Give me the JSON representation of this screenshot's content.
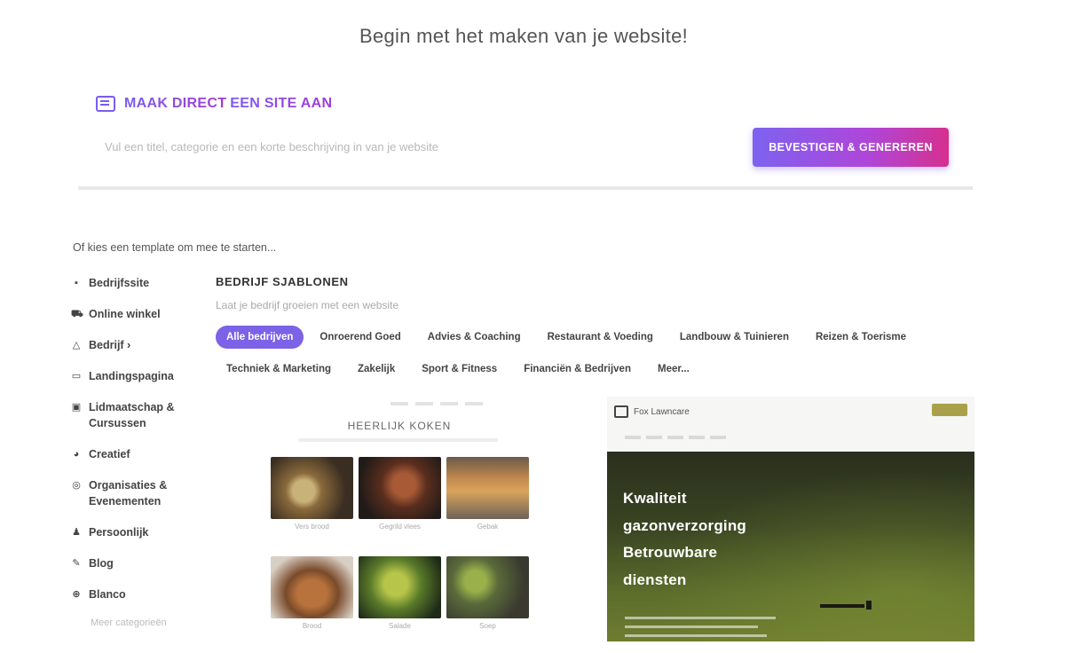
{
  "page": {
    "title": "Begin met het maken van je website!"
  },
  "ai_section": {
    "heading_part1": "MAAK DIRECT",
    "heading_part2": "EEN SITE AAN",
    "input_placeholder": "Vul een titel, categorie en een korte beschrijving in van je website",
    "button_label": "BEVESTIGEN & GENEREREN"
  },
  "choose_text": "Of kies een template om mee te starten...",
  "sidebar": {
    "items": [
      {
        "label": "Bedrijfssite",
        "icon": "briefcase-icon"
      },
      {
        "label": "Online winkel",
        "icon": "cart-icon"
      },
      {
        "label": "Bedrijf ›",
        "icon": "building-icon"
      },
      {
        "label": "Landingspagina",
        "icon": "landing-page-icon"
      },
      {
        "label": "Lidmaatschap & Cursussen",
        "icon": "membership-icon"
      },
      {
        "label": "Creatief",
        "icon": "palette-icon"
      },
      {
        "label": "Organisaties & Evenementen",
        "icon": "globe-icon"
      },
      {
        "label": "Persoonlijk",
        "icon": "person-icon"
      },
      {
        "label": "Blog",
        "icon": "pen-icon"
      },
      {
        "label": "Blanco",
        "icon": "plus-circle-icon"
      }
    ],
    "more_label": "Meer categorieën"
  },
  "templates": {
    "title": "BEDRIJF SJABLONEN",
    "subtitle": "Laat je bedrijf groeien met een website",
    "categories": [
      {
        "label": "Alle bedrijven",
        "active": true
      },
      {
        "label": "Onroerend Goed",
        "active": false
      },
      {
        "label": "Advies & Coaching",
        "active": false
      },
      {
        "label": "Restaurant & Voeding",
        "active": false
      },
      {
        "label": "Landbouw & Tuinieren",
        "active": false
      },
      {
        "label": "Reizen & Toerisme",
        "active": false
      },
      {
        "label": "Techniek & Marketing",
        "active": false
      },
      {
        "label": "Zakelijk",
        "active": false
      },
      {
        "label": "Sport & Fitness",
        "active": false
      },
      {
        "label": "Financiën & Bedrijven",
        "active": false
      },
      {
        "label": "Meer...",
        "active": false
      }
    ]
  },
  "template_left": {
    "title": "HEERLIJK KOKEN",
    "tiles": [
      {
        "caption": "Vers brood"
      },
      {
        "caption": "Gegrild vlees"
      },
      {
        "caption": "Gebak"
      },
      {
        "caption": "Brood"
      },
      {
        "caption": "Salade"
      },
      {
        "caption": "Soep"
      }
    ]
  },
  "template_right": {
    "brand": "Fox Lawncare",
    "hero_lines": [
      "Kwaliteit",
      "gazonverzorging",
      "Betrouwbare",
      "diensten"
    ]
  },
  "colors": {
    "accent": "#7b62e6",
    "gradient_start": "#7d62f0",
    "gradient_end": "#d6308e"
  }
}
